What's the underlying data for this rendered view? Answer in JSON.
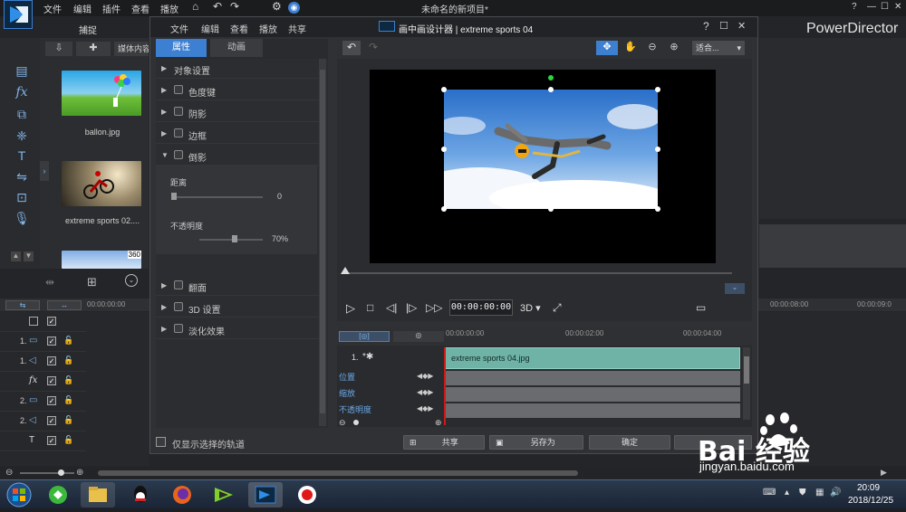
{
  "app": {
    "title": "未命名的新项目*",
    "brand": "PowerDirector",
    "menu": [
      "文件",
      "编辑",
      "插件",
      "查看",
      "播放"
    ],
    "capture_tab": "捕捉",
    "media_content_label": "媒体内容",
    "media": [
      {
        "name": "ballon.jpg"
      },
      {
        "name": "extreme sports 02...."
      }
    ],
    "third_thumb_badge": "360",
    "main_ruler": [
      "00:00:00:00",
      "00:00:08:00",
      "00:00:09:0"
    ]
  },
  "dialog": {
    "title": "画中画设计器 | extreme sports 04",
    "help": "?",
    "menu": [
      "文件",
      "编辑",
      "查看",
      "播放",
      "共享"
    ],
    "tabs": {
      "properties": "属性",
      "animation": "动画"
    },
    "props": {
      "object_settings": "对象设置",
      "chroma_key": "色度键",
      "shadow": "阴影",
      "border": "边框",
      "reflection": "倒影",
      "distance_label": "距离",
      "distance_value": "0",
      "opacity_label": "不透明度",
      "opacity_value": "70%",
      "flip": "翻面",
      "settings_3d": "3D 设置",
      "fade": "淡化效果"
    },
    "show_selected_only": "仅显示选择的轨道",
    "fit_label": "适合...",
    "timecode": "00:00:00:00",
    "mode_3d": "3D",
    "timeline": {
      "ruler": [
        "00:00:00:00",
        "00:00:02:00",
        "00:00:04:00"
      ],
      "track_num": "1.",
      "clip_name": "extreme sports 04.jpg",
      "keyframe_rows": [
        "位置",
        "缩放",
        "不透明度"
      ]
    },
    "buttons": {
      "share": "共享",
      "save_as": "另存为",
      "ok": "确定"
    }
  },
  "tracks": [
    {
      "num": "1."
    },
    {
      "num": "1."
    },
    {
      "num": ""
    },
    {
      "num": "2."
    },
    {
      "num": "2."
    },
    {
      "num": ""
    }
  ],
  "taskbar": {
    "time": "20:09",
    "date": "2018/12/25"
  },
  "watermark": {
    "text": "Bai 经验",
    "url": "jingyan.baidu.com"
  },
  "colors": {
    "accent": "#3d7fd1",
    "clip": "#6fb3a6"
  }
}
